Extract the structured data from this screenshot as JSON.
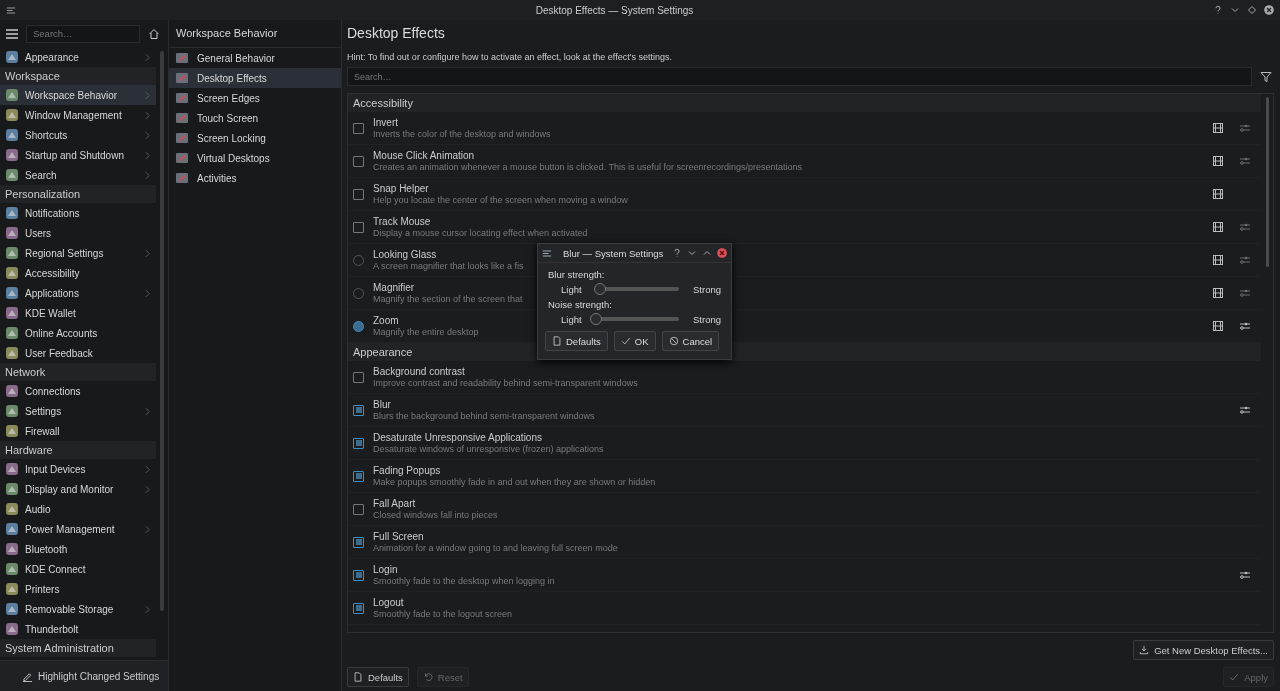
{
  "window": {
    "title": "Desktop Effects — System Settings"
  },
  "sidebar": {
    "search": {
      "placeholder": "Search…"
    },
    "items": [
      {
        "kind": "item",
        "label": "Appearance",
        "arrow": true,
        "selected": false
      },
      {
        "kind": "header",
        "label": "Workspace"
      },
      {
        "kind": "item",
        "label": "Workspace Behavior",
        "arrow": true,
        "selected": true
      },
      {
        "kind": "item",
        "label": "Window Management",
        "arrow": true,
        "selected": false
      },
      {
        "kind": "item",
        "label": "Shortcuts",
        "arrow": true,
        "selected": false
      },
      {
        "kind": "item",
        "label": "Startup and Shutdown",
        "arrow": true,
        "selected": false
      },
      {
        "kind": "item",
        "label": "Search",
        "arrow": true,
        "selected": false
      },
      {
        "kind": "header",
        "label": "Personalization"
      },
      {
        "kind": "item",
        "label": "Notifications",
        "arrow": false,
        "selected": false
      },
      {
        "kind": "item",
        "label": "Users",
        "arrow": false,
        "selected": false
      },
      {
        "kind": "item",
        "label": "Regional Settings",
        "arrow": true,
        "selected": false
      },
      {
        "kind": "item",
        "label": "Accessibility",
        "arrow": false,
        "selected": false
      },
      {
        "kind": "item",
        "label": "Applications",
        "arrow": true,
        "selected": false
      },
      {
        "kind": "item",
        "label": "KDE Wallet",
        "arrow": false,
        "selected": false
      },
      {
        "kind": "item",
        "label": "Online Accounts",
        "arrow": false,
        "selected": false
      },
      {
        "kind": "item",
        "label": "User Feedback",
        "arrow": false,
        "selected": false
      },
      {
        "kind": "header",
        "label": "Network"
      },
      {
        "kind": "item",
        "label": "Connections",
        "arrow": false,
        "selected": false
      },
      {
        "kind": "item",
        "label": "Settings",
        "arrow": true,
        "selected": false
      },
      {
        "kind": "item",
        "label": "Firewall",
        "arrow": false,
        "selected": false
      },
      {
        "kind": "header",
        "label": "Hardware"
      },
      {
        "kind": "item",
        "label": "Input Devices",
        "arrow": true,
        "selected": false
      },
      {
        "kind": "item",
        "label": "Display and Monitor",
        "arrow": true,
        "selected": false
      },
      {
        "kind": "item",
        "label": "Audio",
        "arrow": false,
        "selected": false
      },
      {
        "kind": "item",
        "label": "Power Management",
        "arrow": true,
        "selected": false
      },
      {
        "kind": "item",
        "label": "Bluetooth",
        "arrow": false,
        "selected": false
      },
      {
        "kind": "item",
        "label": "KDE Connect",
        "arrow": false,
        "selected": false
      },
      {
        "kind": "item",
        "label": "Printers",
        "arrow": false,
        "selected": false
      },
      {
        "kind": "item",
        "label": "Removable Storage",
        "arrow": true,
        "selected": false
      },
      {
        "kind": "item",
        "label": "Thunderbolt",
        "arrow": false,
        "selected": false
      },
      {
        "kind": "header",
        "label": "System Administration"
      }
    ],
    "footer_button": "Highlight Changed Settings"
  },
  "subpanel": {
    "title": "Workspace Behavior",
    "items": [
      {
        "label": "General Behavior",
        "selected": false
      },
      {
        "label": "Desktop Effects",
        "selected": true
      },
      {
        "label": "Screen Edges",
        "selected": false
      },
      {
        "label": "Touch Screen",
        "selected": false
      },
      {
        "label": "Screen Locking",
        "selected": false
      },
      {
        "label": "Virtual Desktops",
        "selected": false
      },
      {
        "label": "Activities",
        "selected": false
      }
    ]
  },
  "main": {
    "title": "Desktop Effects",
    "hint": "Hint: To find out or configure how to activate an effect, look at the effect's settings.",
    "search": {
      "placeholder": "Search…"
    },
    "sections": [
      {
        "title": "Accessibility",
        "effects": [
          {
            "name": "Invert",
            "description": "Inverts the color of the desktop and windows",
            "kind": "checkbox",
            "checked": false,
            "video": true,
            "configure": true
          },
          {
            "name": "Mouse Click Animation",
            "description": "Creates an animation whenever a mouse button is clicked. This is useful for screenrecordings/presentations",
            "kind": "checkbox",
            "checked": false,
            "video": true,
            "configure": true
          },
          {
            "name": "Snap Helper",
            "description": "Help you locate the center of the screen when moving a window",
            "kind": "checkbox",
            "checked": false,
            "video": true,
            "configure": false
          },
          {
            "name": "Track Mouse",
            "description": "Display a mouse cursor locating effect when activated",
            "kind": "checkbox",
            "checked": false,
            "video": true,
            "configure": true
          },
          {
            "name": "Looking Glass",
            "description": "A screen magnifier that looks like a fis",
            "kind": "radio",
            "checked": false,
            "video": true,
            "configure": true
          },
          {
            "name": "Magnifier",
            "description": "Magnify the section of the screen that",
            "kind": "radio",
            "checked": false,
            "video": true,
            "configure": true
          },
          {
            "name": "Zoom",
            "description": "Magnify the entire desktop",
            "kind": "radio",
            "checked": true,
            "video": true,
            "configure": true
          }
        ]
      },
      {
        "title": "Appearance",
        "effects": [
          {
            "name": "Background contrast",
            "description": "Improve contrast and readability behind semi-transparent windows",
            "kind": "checkbox",
            "checked": false,
            "video": false,
            "configure": false
          },
          {
            "name": "Blur",
            "description": "Blurs the background behind semi-transparent windows",
            "kind": "checkbox",
            "checked": true,
            "video": false,
            "configure": true
          },
          {
            "name": "Desaturate Unresponsive Applications",
            "description": "Desaturate windows of unresponsive (frozen) applications",
            "kind": "checkbox",
            "checked": true,
            "video": false,
            "configure": false
          },
          {
            "name": "Fading Popups",
            "description": "Make popups smoothly fade in and out when they are shown or hidden",
            "kind": "checkbox",
            "checked": true,
            "video": false,
            "configure": false
          },
          {
            "name": "Fall Apart",
            "description": "Closed windows fall into pieces",
            "kind": "checkbox",
            "checked": false,
            "video": false,
            "configure": false
          },
          {
            "name": "Full Screen",
            "description": "Animation for a window going to and leaving full screen mode",
            "kind": "checkbox",
            "checked": true,
            "video": false,
            "configure": false
          },
          {
            "name": "Login",
            "description": "Smoothly fade to the desktop when logging in",
            "kind": "checkbox",
            "checked": true,
            "video": false,
            "configure": true
          },
          {
            "name": "Logout",
            "description": "Smoothly fade to the logout screen",
            "kind": "checkbox",
            "checked": true,
            "video": false,
            "configure": false
          }
        ]
      }
    ],
    "get_new_button": "Get New Desktop Effects...",
    "buttons": [
      {
        "label": "Defaults",
        "kind": "defaults",
        "disabled": false
      },
      {
        "label": "Reset",
        "kind": "reset",
        "disabled": true
      }
    ],
    "apply_button": {
      "label": "Apply",
      "disabled": true
    }
  },
  "dialog": {
    "title": "Blur — System Settings",
    "sliders": [
      {
        "label": "Blur strength:",
        "min_label": "Light",
        "max_label": "Strong",
        "level": 0.05
      },
      {
        "label": "Noise strength:",
        "min_label": "Light",
        "max_label": "Strong",
        "level": 0
      }
    ],
    "buttons": [
      {
        "label": "Defaults",
        "kind": "defaults"
      },
      {
        "label": "OK",
        "kind": "ok"
      },
      {
        "label": "Cancel",
        "kind": "cancel"
      }
    ]
  }
}
